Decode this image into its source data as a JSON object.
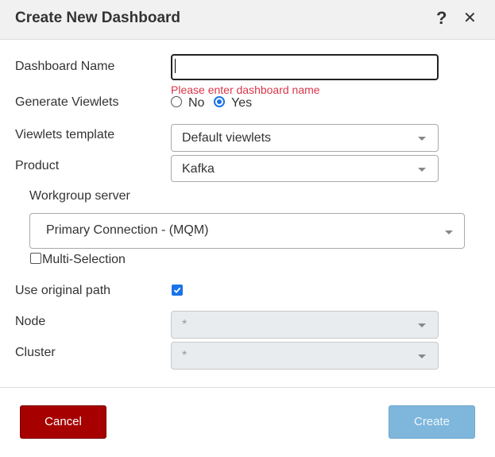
{
  "dialog": {
    "title": "Create New Dashboard",
    "help_symbol": "?",
    "close_symbol": "✕"
  },
  "form": {
    "dashboard_name": {
      "label": "Dashboard Name",
      "value": "",
      "error": "Please enter dashboard name"
    },
    "generate_viewlets": {
      "label": "Generate Viewlets",
      "options": [
        "No",
        "Yes"
      ],
      "selected": "Yes"
    },
    "viewlets_template": {
      "label": "Viewlets template",
      "value": "Default viewlets"
    },
    "product": {
      "label": "Product",
      "value": "Kafka"
    },
    "workgroup_server": {
      "label": "Workgroup server",
      "value": "Primary Connection - (MQM)"
    },
    "multi_selection": {
      "label": "Multi-Selection",
      "checked": false
    },
    "use_original_path": {
      "label": "Use original path",
      "checked": true
    },
    "node": {
      "label": "Node",
      "value": "*",
      "disabled": true
    },
    "cluster": {
      "label": "Cluster",
      "value": "*",
      "disabled": true
    }
  },
  "buttons": {
    "cancel": "Cancel",
    "create": "Create"
  },
  "colors": {
    "accent": "#1a73e8",
    "error": "#d9364a",
    "cancel_bg": "#a60000",
    "create_bg": "#7fb7dc"
  },
  "icons": {
    "help": "help-icon",
    "close": "close-icon",
    "dropdown": "chevron-down-icon",
    "check": "check-icon"
  }
}
